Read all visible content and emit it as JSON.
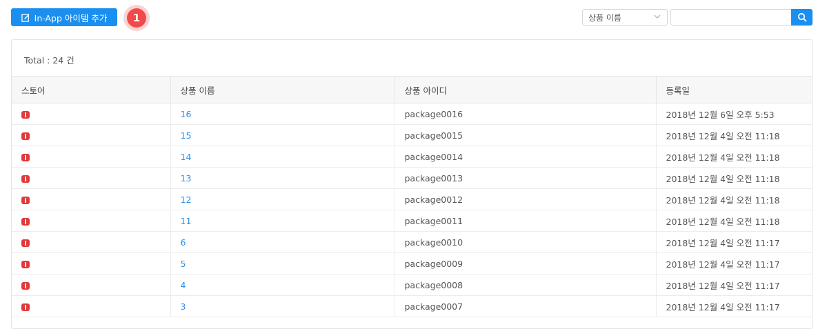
{
  "toolbar": {
    "add_button_label": "In-App 아이템 추가",
    "step_badge": "1",
    "filter_select_value": "상품 이름",
    "search_input_value": ""
  },
  "summary": {
    "total_text": "Total : 24 건"
  },
  "table": {
    "columns": [
      "스토어",
      "상품 이름",
      "상품 아이디",
      "등록일"
    ],
    "rows": [
      {
        "store_icon": "store-badge-icon",
        "name": "16",
        "product_id": "package0016",
        "date": "2018년 12월 6일 오후 5:53"
      },
      {
        "store_icon": "store-badge-icon",
        "name": "15",
        "product_id": "package0015",
        "date": "2018년 12월 4일 오전 11:18"
      },
      {
        "store_icon": "store-badge-icon",
        "name": "14",
        "product_id": "package0014",
        "date": "2018년 12월 4일 오전 11:18"
      },
      {
        "store_icon": "store-badge-icon",
        "name": "13",
        "product_id": "package0013",
        "date": "2018년 12월 4일 오전 11:18"
      },
      {
        "store_icon": "store-badge-icon",
        "name": "12",
        "product_id": "package0012",
        "date": "2018년 12월 4일 오전 11:18"
      },
      {
        "store_icon": "store-badge-icon",
        "name": "11",
        "product_id": "package0011",
        "date": "2018년 12월 4일 오전 11:18"
      },
      {
        "store_icon": "store-badge-icon",
        "name": "6",
        "product_id": "package0010",
        "date": "2018년 12월 4일 오전 11:17"
      },
      {
        "store_icon": "store-badge-icon",
        "name": "5",
        "product_id": "package0009",
        "date": "2018년 12월 4일 오전 11:17"
      },
      {
        "store_icon": "store-badge-icon",
        "name": "4",
        "product_id": "package0008",
        "date": "2018년 12월 4일 오전 11:17"
      },
      {
        "store_icon": "store-badge-icon",
        "name": "3",
        "product_id": "package0007",
        "date": "2018년 12월 4일 오전 11:17"
      }
    ]
  },
  "colors": {
    "accent": "#1a8ff0",
    "link": "#2f8fe6",
    "store_badge": "#e0393b",
    "step_badge": "#f24a4a"
  }
}
